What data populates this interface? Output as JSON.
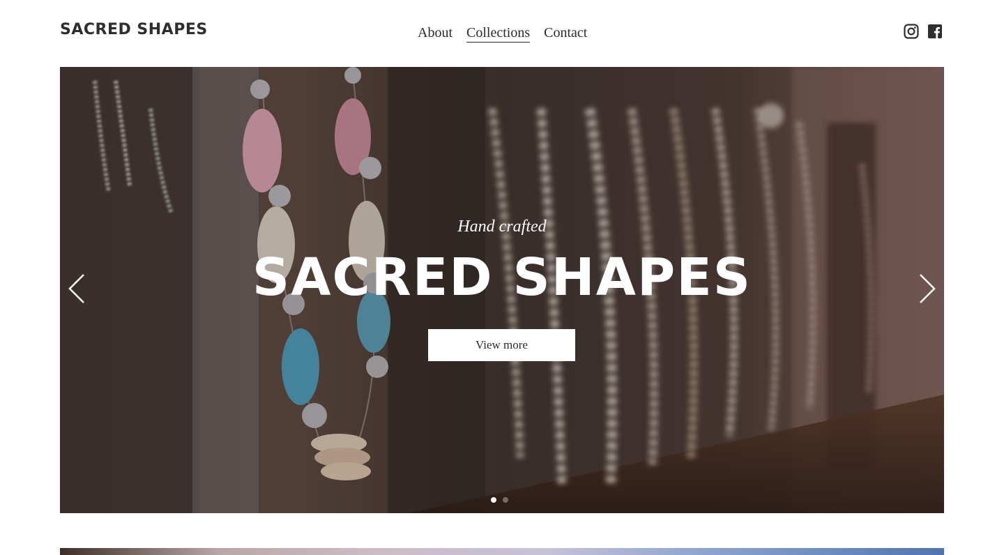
{
  "site": {
    "logo": "SACRED SHAPES"
  },
  "nav": {
    "items": [
      {
        "label": "About",
        "active": false
      },
      {
        "label": "Collections",
        "active": true
      },
      {
        "label": "Contact",
        "active": false
      }
    ]
  },
  "social": {
    "icons": [
      "instagram-icon",
      "facebook-icon"
    ]
  },
  "hero": {
    "eyebrow": "Hand crafted",
    "title": "SACRED SHAPES",
    "cta_label": "View more",
    "slides_total": 2,
    "current_slide": 1
  },
  "colors": {
    "text": "#2b2b2b",
    "hero_text": "#ffffff",
    "button_bg": "#ffffff"
  }
}
